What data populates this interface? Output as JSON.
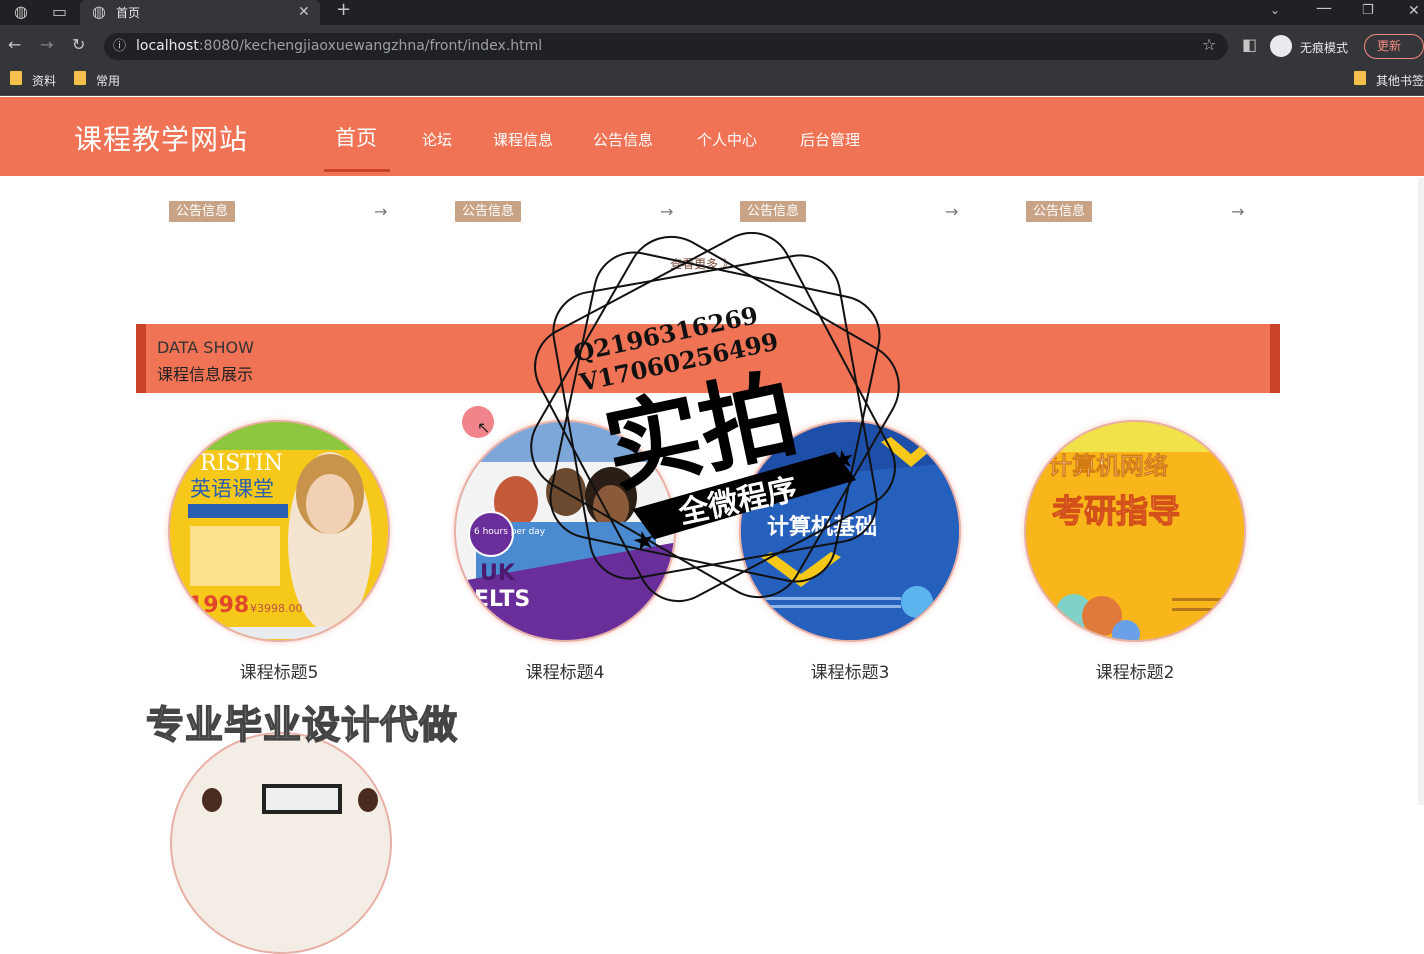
{
  "browser": {
    "tab_title": "首页",
    "url_host": "localhost",
    "url_rest": ":8080/kechengjiaoxuewangzhna/front/index.html",
    "incognito_label": "无痕模式",
    "update_label": "更新",
    "bookmarks": [
      {
        "label": "资料"
      },
      {
        "label": "常用"
      }
    ],
    "other_bookmarks": "其他书签"
  },
  "site": {
    "title": "课程教学网站",
    "nav": [
      {
        "label": "首页",
        "active": true
      },
      {
        "label": "论坛"
      },
      {
        "label": "课程信息"
      },
      {
        "label": "公告信息"
      },
      {
        "label": "个人中心"
      },
      {
        "label": "后台管理"
      }
    ]
  },
  "notices": [
    {
      "tag": "公告信息",
      "arrow": "→"
    },
    {
      "tag": "公告信息",
      "arrow": "→"
    },
    {
      "tag": "公告信息",
      "arrow": "→"
    },
    {
      "tag": "公告信息",
      "arrow": "→"
    }
  ],
  "more_link": "查看更多 》",
  "data_show": {
    "en": "DATA SHOW",
    "cn": "课程信息展示"
  },
  "courses": [
    {
      "title": "课程标题5",
      "image_text": [
        "英语课堂",
        "RISTIN",
        "1998",
        "¥3998.00"
      ],
      "theme": "#f6c81a"
    },
    {
      "title": "课程标题4",
      "image_text": [
        "6 hours per day",
        "UK",
        "ELTS"
      ],
      "theme": "#6a2e9b"
    },
    {
      "title": "课程标题3",
      "image_text": [
        "计算机基础"
      ],
      "theme": "#1e4fa8"
    },
    {
      "title": "课程标题2",
      "image_text": [
        "计算机网络",
        "考研指导"
      ],
      "theme": "#f8b61a"
    }
  ],
  "watermark": {
    "banner": "专业毕业设计代做",
    "stamp_line1": "Q2196316269",
    "stamp_line2": "V17060256499",
    "stamp_main": "实拍",
    "stamp_sub": "全微程序"
  },
  "colors": {
    "brand": "#f07356",
    "brand_dark": "#c9432b",
    "tag_bg": "#c9a386"
  }
}
